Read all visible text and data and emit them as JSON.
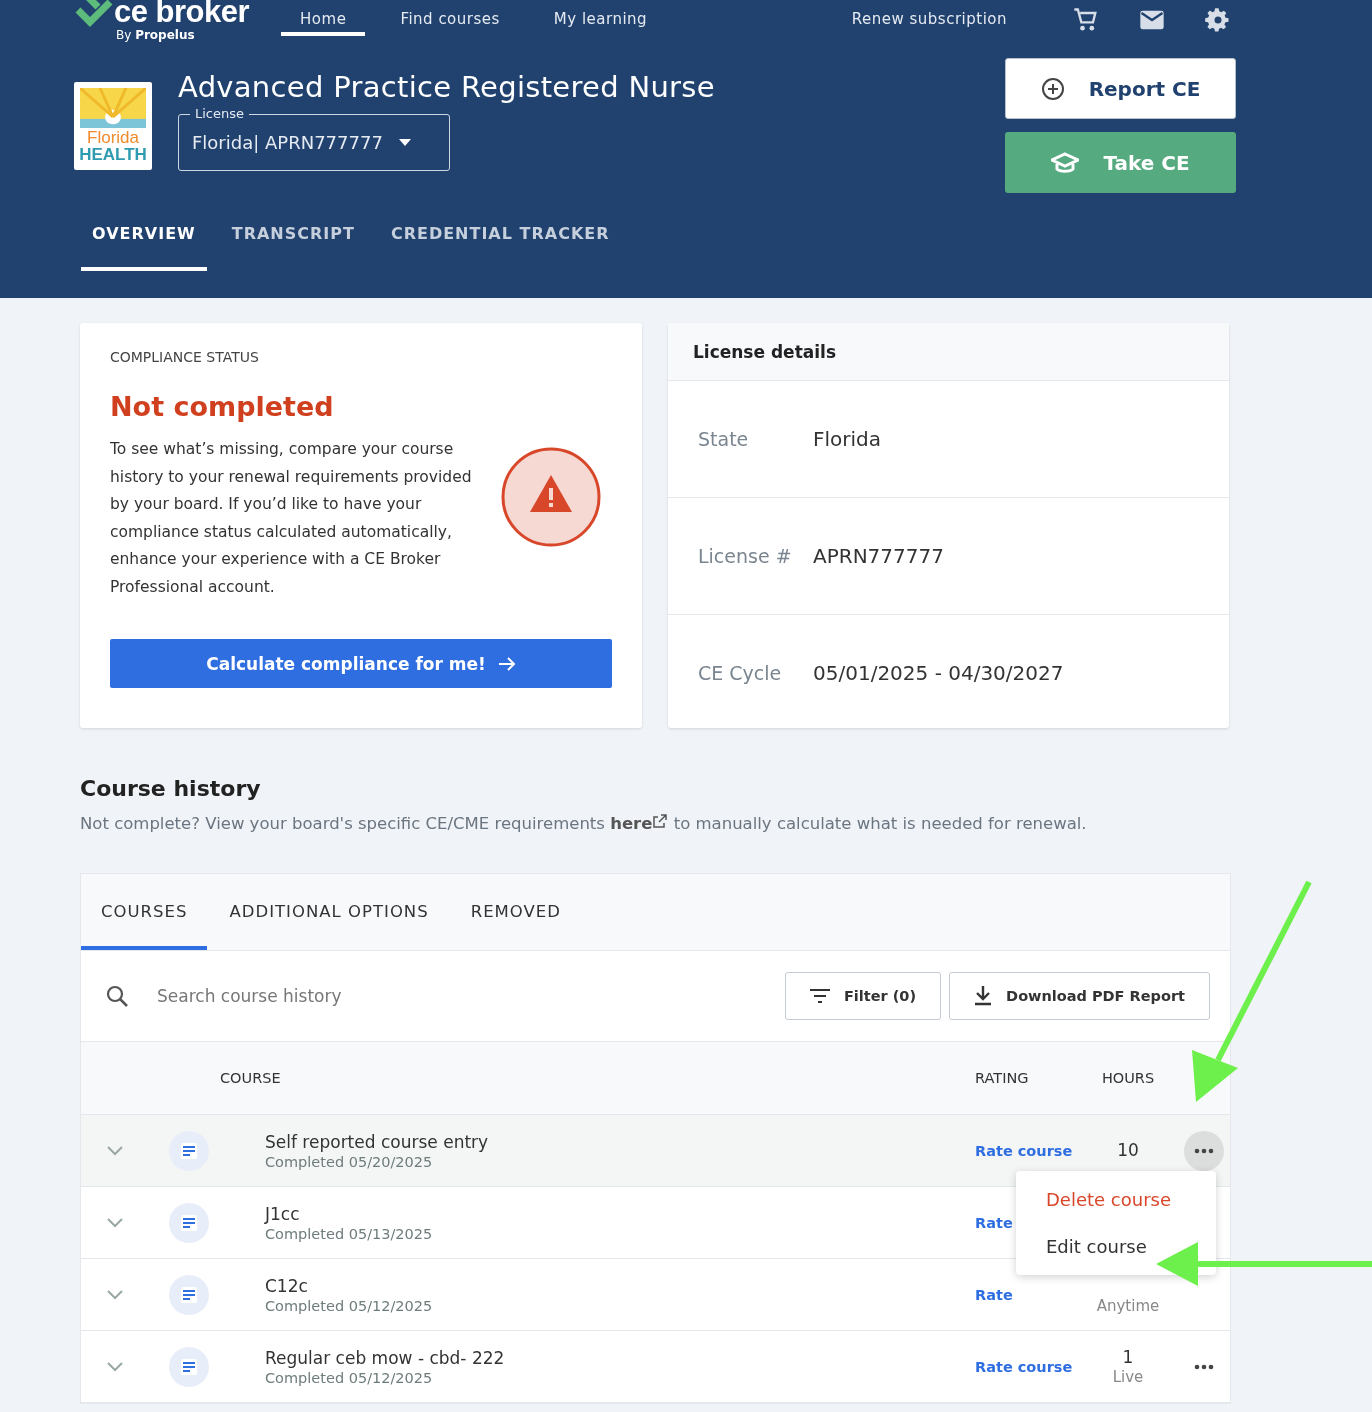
{
  "brand": {
    "name": "ce broker",
    "byline": "By",
    "company": "Propelus"
  },
  "nav": [
    {
      "label": "Home",
      "selected": true
    },
    {
      "label": "Find courses",
      "selected": false
    },
    {
      "label": "My learning",
      "selected": false
    }
  ],
  "nav_right": {
    "link": "Renew subscription"
  },
  "profile": {
    "title": "Advanced Practice Registered Nurse",
    "logo_top": "Florida",
    "logo_bottom": "HEALTH",
    "license_label": "License",
    "license_value": "Florida| APRN777777"
  },
  "actions": [
    {
      "kind": "outline",
      "label": "Report CE"
    },
    {
      "kind": "primary",
      "label": "Take CE"
    }
  ],
  "tabs": [
    {
      "label": "OVERVIEW",
      "selected": true
    },
    {
      "label": "TRANSCRIPT",
      "selected": false
    },
    {
      "label": "CREDENTIAL TRACKER",
      "selected": false
    }
  ],
  "compliance": {
    "heading": "COMPLIANCE STATUS",
    "status": "Not completed",
    "text": "To see what’s missing, compare your course history to your renewal requirements provided by your board. If you’d like to have your compliance status calculated automatically, enhance your experience with a CE Broker Professional account.",
    "button": "Calculate compliance for me!"
  },
  "license_details": {
    "title": "License details",
    "rows": [
      {
        "label": "State",
        "value": "Florida"
      },
      {
        "label": "License #",
        "value": "APRN777777"
      },
      {
        "label": "CE Cycle",
        "value": "05/01/2025 - 04/30/2027"
      }
    ]
  },
  "course_history": {
    "title": "Course history",
    "note_before": "Not complete? View your board's specific CE/CME requirements",
    "link": "here",
    "note_after": "to manually calculate what is needed for renewal.",
    "tabs": [
      {
        "label": "COURSES",
        "selected": true
      },
      {
        "label": "ADDITIONAL OPTIONS",
        "selected": false
      },
      {
        "label": "REMOVED",
        "selected": false
      }
    ],
    "search": {
      "placeholder": "Search course history"
    },
    "filter": "Filter (0)",
    "download": "Download PDF Report",
    "columns": [
      "COURSE",
      "RATING",
      "HOURS"
    ],
    "rows": [
      {
        "title": "Self reported course entry",
        "completed": "Completed 05/20/2025",
        "rating": "Rate course",
        "hours": "10",
        "menu_open": true
      },
      {
        "title": "J1cc",
        "completed": "Completed 05/13/2025",
        "rating": "Rate",
        "menu_open": false
      },
      {
        "title": "C12c",
        "completed": "Completed 05/12/2025",
        "rating": "Rate",
        "hours_type": "Anytime",
        "menu_open": false
      },
      {
        "title": "Regular ceb mow - cbd- 222",
        "completed": "Completed 05/12/2025",
        "rating": "Rate course",
        "hours": "1",
        "hours_type": "Live",
        "menu_open": false
      }
    ],
    "menu": {
      "items": [
        {
          "kind": "danger",
          "label": "Delete course"
        },
        {
          "kind": "normal",
          "label": "Edit course"
        }
      ]
    }
  }
}
